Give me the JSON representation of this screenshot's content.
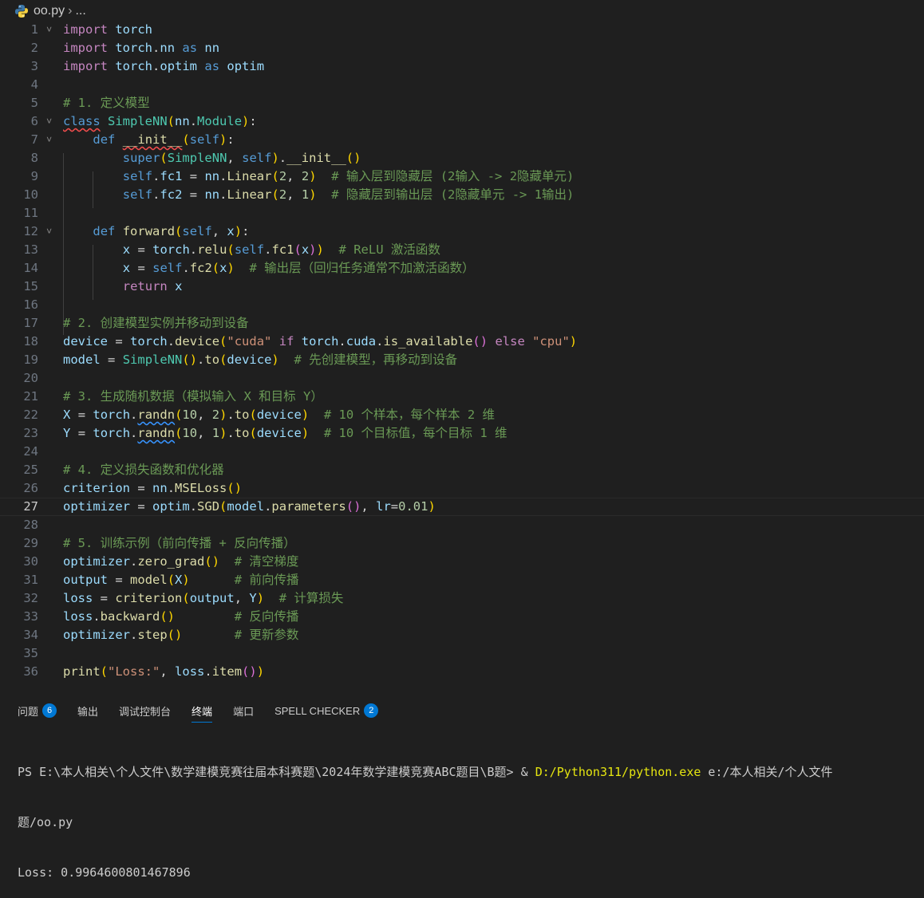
{
  "breadcrumb": {
    "file": "oo.py",
    "sep": "›",
    "rest": "..."
  },
  "editor": {
    "current_line": 27,
    "lines": [
      "import torch",
      "import torch.nn as nn",
      "import torch.optim as optim",
      "",
      "# 1. 定义模型",
      "class SimpleNN(nn.Module):",
      "    def __init__(self):",
      "        super(SimpleNN, self).__init__()",
      "        self.fc1 = nn.Linear(2, 2)  # 输入层到隐藏层 (2输入 -> 2隐藏单元)",
      "        self.fc2 = nn.Linear(2, 1)  # 隐藏层到输出层 (2隐藏单元 -> 1输出)",
      "",
      "    def forward(self, x):",
      "        x = torch.relu(self.fc1(x))  # ReLU 激活函数",
      "        x = self.fc2(x)  # 输出层（回归任务通常不加激活函数）",
      "        return x",
      "",
      "# 2. 创建模型实例并移动到设备",
      "device = torch.device(\"cuda\" if torch.cuda.is_available() else \"cpu\")",
      "model = SimpleNN().to(device)  # 先创建模型，再移动到设备",
      "",
      "# 3. 生成随机数据（模拟输入 X 和目标 Y）",
      "X = torch.randn(10, 2).to(device)  # 10 个样本，每个样本 2 维",
      "Y = torch.randn(10, 1).to(device)  # 10 个目标值，每个目标 1 维",
      "",
      "# 4. 定义损失函数和优化器",
      "criterion = nn.MSELoss()",
      "optimizer = optim.SGD(model.parameters(), lr=0.01)",
      "",
      "# 5. 训练示例（前向传播 + 反向传播）",
      "optimizer.zero_grad()  # 清空梯度",
      "output = model(X)      # 前向传播",
      "loss = criterion(output, Y)  # 计算损失",
      "loss.backward()        # 反向传播",
      "optimizer.step()       # 更新参数",
      "",
      "print(\"Loss:\", loss.item())"
    ]
  },
  "panel": {
    "tabs": [
      {
        "label": "问题",
        "badge": "6"
      },
      {
        "label": "输出"
      },
      {
        "label": "调试控制台"
      },
      {
        "label": "终端",
        "active": true
      },
      {
        "label": "端口"
      },
      {
        "label": "SPELL CHECKER",
        "badge": "2"
      }
    ]
  },
  "terminal": {
    "prompt": "PS E:\\本人相关\\个人文件\\数学建模竞赛往届本科赛题\\2024年数学建模竞赛ABC题目\\B题> & ",
    "exe": "D:/Python311/python.exe",
    "arg": " e:/本人相关/个人文件",
    "arg_cont": "题/oo.py",
    "output": "Loss: 0.9964600801467896"
  },
  "colors": {
    "accent": "#0078d4",
    "background": "#1f1f1f"
  }
}
